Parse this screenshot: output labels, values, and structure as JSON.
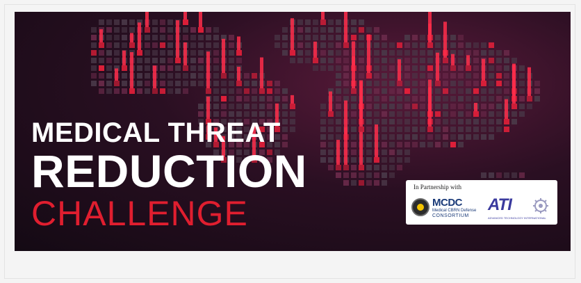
{
  "banner": {
    "title_line1": "MEDICAL THREAT",
    "title_line2": "REDUCTION",
    "title_line3": "CHALLENGE",
    "partner_header": "In Partnership with",
    "mcdc": {
      "name": "MCDC",
      "sub_line": "Medical CBRN Defense",
      "consortium": "CONSORTIUM"
    },
    "ati": {
      "name": "ATI",
      "sub_line": "ADVANCED TECHNOLOGY INTERNATIONAL"
    }
  },
  "colors": {
    "accent_red": "#e01e2f",
    "background_dark": "#1a0c18",
    "title_white": "#ffffff",
    "ati_blue": "#3a3a9e",
    "mcdc_blue": "#1a3a78"
  },
  "icons": [
    "world-map-pixel-graphic",
    "mcdc-seal-icon",
    "ati-gear-icon"
  ]
}
